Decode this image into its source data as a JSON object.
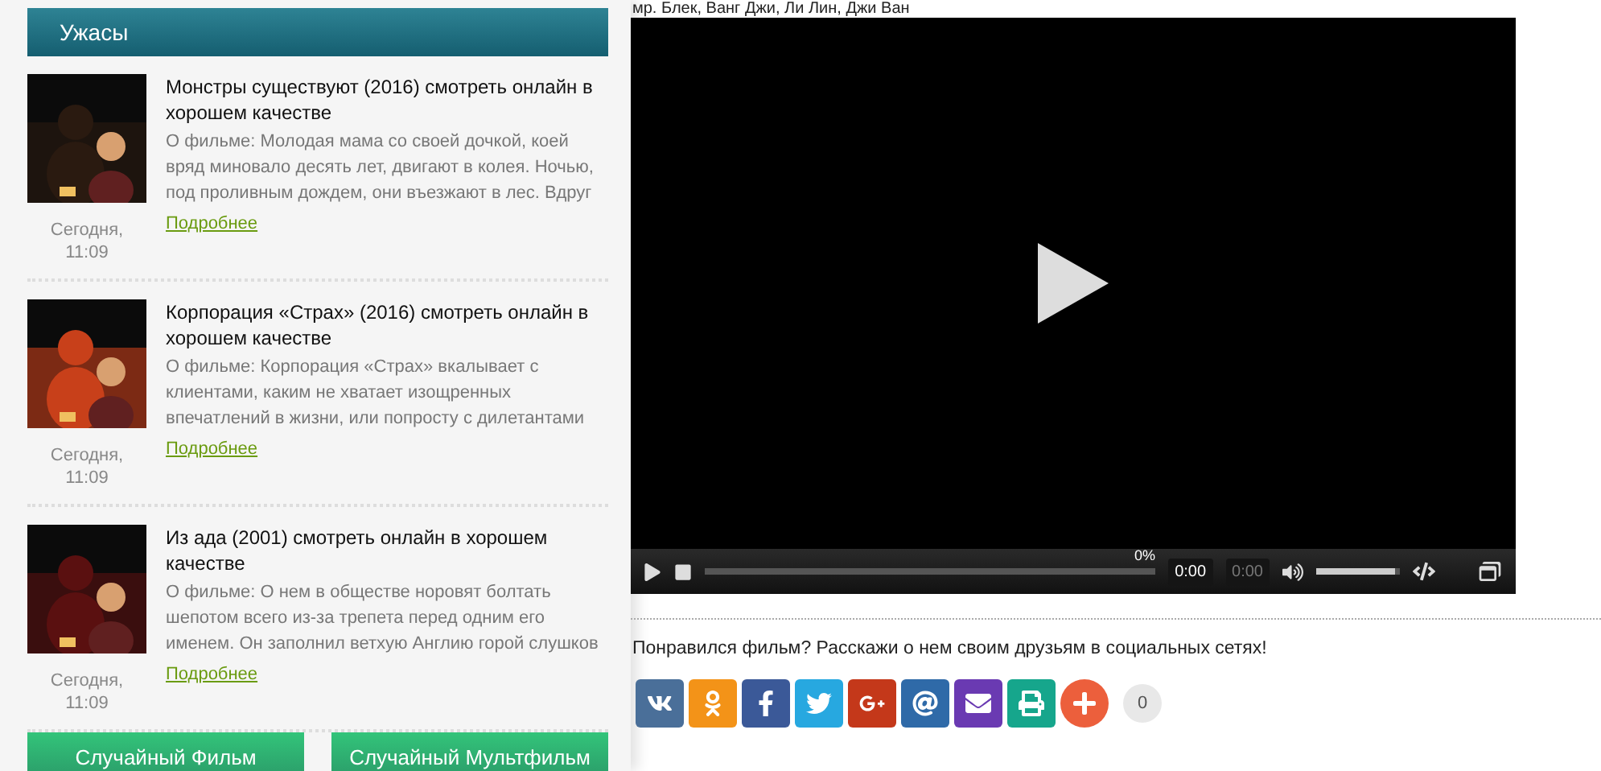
{
  "sidebar": {
    "heading": "Ужасы",
    "movies": [
      {
        "title": "Монстры существуют (2016) смотреть онлайн в хорошем качестве",
        "description": "О фильме: Молодая мама со своей дочкой, коей вряд миновало десять лет, двигают в колея. Ночью, под проливным дождем, они въезжают в лес. Вдруг",
        "date": "Сегодня, 11:09",
        "more": "Подробнее"
      },
      {
        "title": "Корпорация «Страх» (2016) смотреть онлайн в хорошем качестве",
        "description": "О фильме: Корпорация «Страх» вкалывает с клиентами, каким не хватает изощренных впечатлений в жизни, или попросту с дилетантами",
        "date": "Сегодня, 11:09",
        "more": "Подробнее"
      },
      {
        "title": "Из ада (2001) смотреть онлайн в хорошем качестве",
        "description": "О фильме: О нем в обществе норовят болтать шепотом всего из-за трепета перед одним его именем. Он заполнил ветхую Англию горой слушков",
        "date": "Сегодня, 11:09",
        "more": "Подробнее"
      }
    ],
    "buttons": [
      "Случайный Фильм",
      "Случайный Мультфильм"
    ]
  },
  "cast": "мр. Блек, Ванг Джи, Ли Лин, Джи Ван",
  "player": {
    "progress_label": "0%",
    "time": "0:00",
    "duration": "0:00",
    "volume": {
      "level": 0.95
    }
  },
  "share": {
    "prompt": "Понравился фильм? Расскажи о нем своим друзьям в социальных сетях!",
    "buttons": [
      {
        "kind": "vk",
        "color": "#4a6f99"
      },
      {
        "kind": "ok",
        "color": "#f39318"
      },
      {
        "kind": "facebook",
        "color": "#3b5998"
      },
      {
        "kind": "twitter",
        "color": "#27a8e0"
      },
      {
        "kind": "gplus",
        "color": "#c4381a"
      },
      {
        "kind": "mail",
        "color": "#2f6aa8"
      },
      {
        "kind": "email",
        "color": "#6a3ab2"
      },
      {
        "kind": "print",
        "color": "#16a68c"
      },
      {
        "kind": "more",
        "color": "#ec5f3c"
      }
    ],
    "count": "0"
  }
}
